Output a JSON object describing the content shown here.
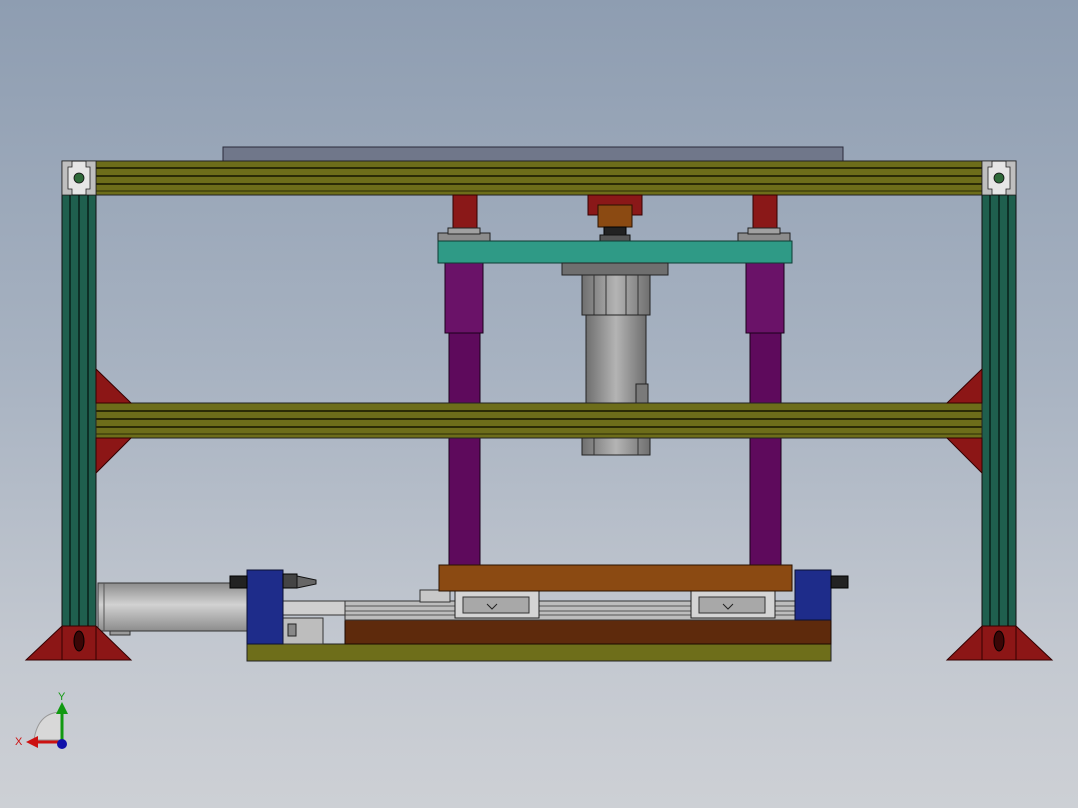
{
  "view": {
    "background_top": "#8e9db1",
    "background_bottom": "#cdd0d5"
  },
  "colors": {
    "frame_profile": "#1f5f4e",
    "beam": "#6d6d1a",
    "beam_stripe": "#2b2b06",
    "top_plate": "#70778a",
    "gusset": "#8c1616",
    "guide_post": "#5e0a5c",
    "bushing": "#8a1818",
    "moving_plate": "#2f9a86",
    "motor_body": "#8a8a8a",
    "press_plate": "#8b4a12",
    "base_wood": "#5e2a0c",
    "base_plate": "#6e6e1a",
    "cylinder": "#a9a9a9",
    "end_block": "#1e2c8a"
  },
  "triad": {
    "x_label": "X",
    "y_label": "Y",
    "x_color": "#cc1111",
    "y_color": "#119911",
    "z_color": "#1111aa"
  }
}
